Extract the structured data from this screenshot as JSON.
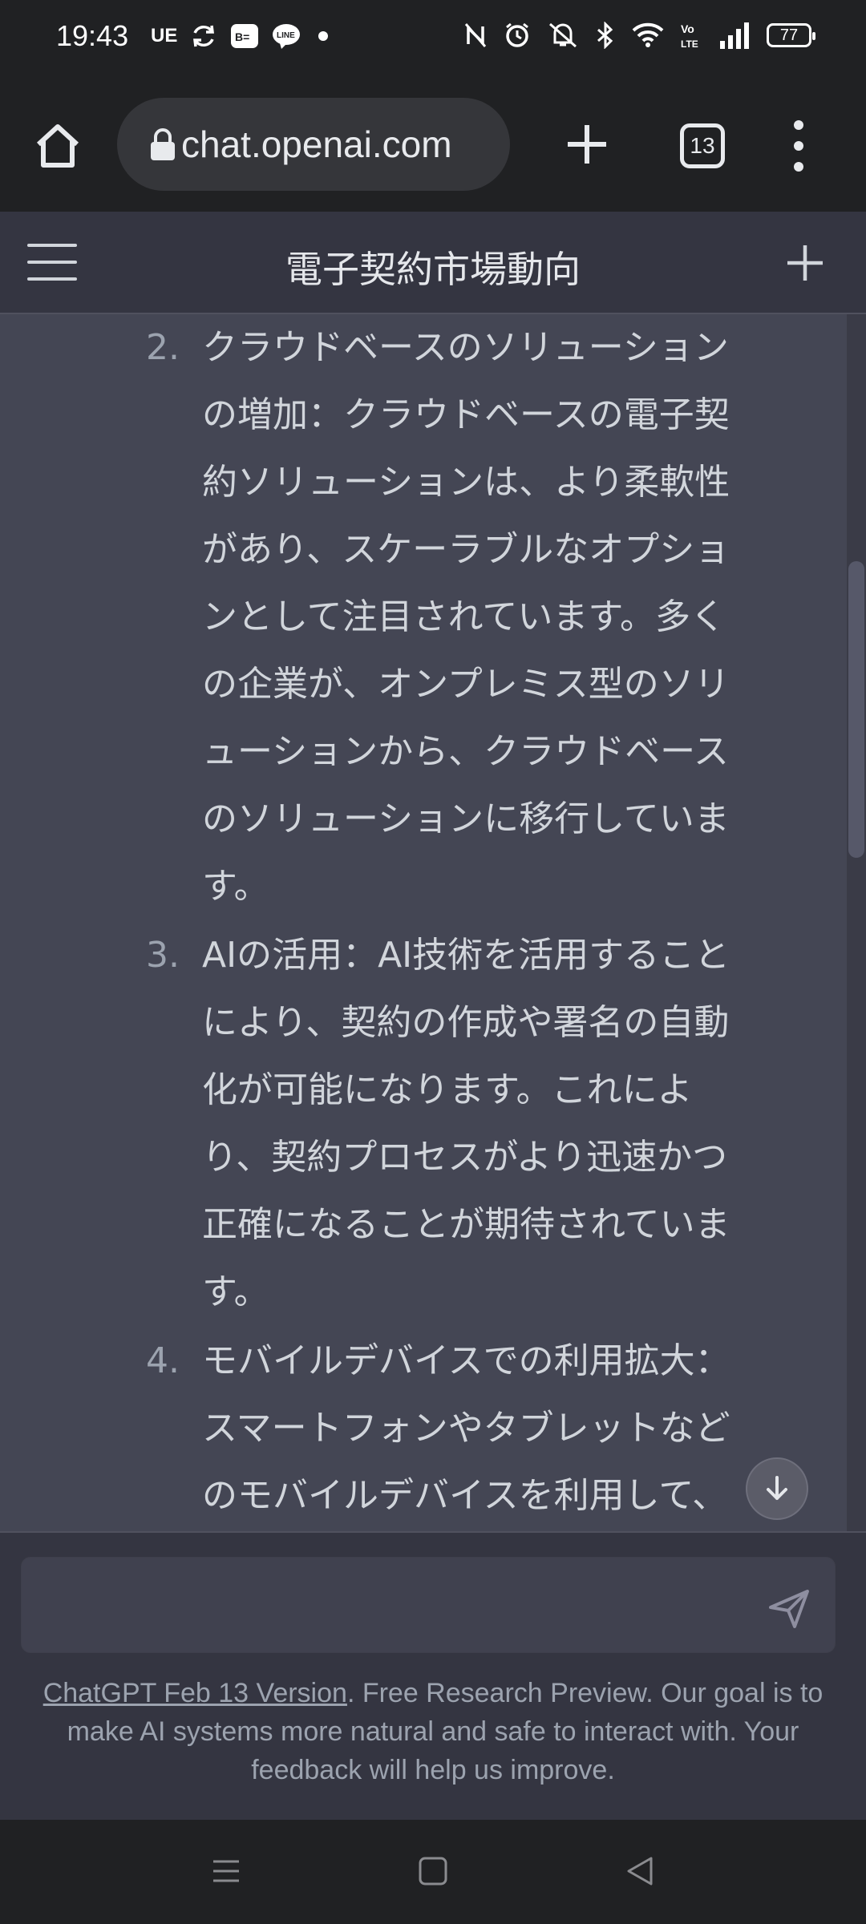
{
  "status_bar": {
    "time": "19:43",
    "left_icons": [
      "ue-indicator",
      "sync-icon",
      "bb-app-icon",
      "line-icon",
      "dot-icon"
    ],
    "ue_label": "UE",
    "right_icons": [
      "nfc-off-icon",
      "alarm-icon",
      "mute-icon",
      "bluetooth-icon",
      "wifi-icon",
      "volte-icon",
      "signal-icon",
      "battery-icon"
    ],
    "battery_level": "77"
  },
  "browser": {
    "url": "chat.openai.com",
    "tab_count": "13",
    "icons": [
      "home-icon",
      "lock-icon",
      "new-tab-icon",
      "tab-switcher-icon",
      "overflow-menu-icon"
    ]
  },
  "header": {
    "title": "電子契約市場動向",
    "icons": [
      "hamburger-menu-icon",
      "new-chat-icon"
    ]
  },
  "message": {
    "items": [
      {
        "number": "2.",
        "lines": [
          "クラウドベースのソリューション",
          "の増加：クラウドベースの電子契",
          "約ソリューションは、より柔軟性",
          "があり、スケーラブルなオプショ",
          "ンとして注目されています。多く",
          "の企業が、オンプレミス型のソリ",
          "ューションから、クラウドベース",
          "のソリューションに移行していま",
          "す。"
        ]
      },
      {
        "number": "3.",
        "lines": [
          "AIの活用：AI技術を活用すること",
          "により、契約の作成や署名の自動",
          "化が可能になります。これによ",
          "り、契約プロセスがより迅速かつ",
          "正確になることが期待されていま",
          "す。"
        ]
      },
      {
        "number": "4.",
        "lines": [
          "モバイルデバイスでの利用拡大：",
          "スマートフォンやタブレットなど",
          "のモバイルデバイスを利用して、"
        ]
      }
    ]
  },
  "composer": {
    "placeholder": "",
    "send_icon": "send-icon",
    "scroll_down_icon": "arrow-down-icon"
  },
  "footer": {
    "link_text": "ChatGPT Feb 13 Version",
    "text": ". Free Research Preview. Our goal is to make AI systems more natural and safe to interact with. Your feedback will help us improve."
  },
  "nav_bar": {
    "icons": [
      "recents-icon",
      "home-square-icon",
      "back-icon"
    ]
  },
  "colors": {
    "status_bg": "#202123",
    "header_bg": "#343541",
    "message_bg": "#444654",
    "text": "#d1d5db",
    "muted": "#9ca3af"
  }
}
